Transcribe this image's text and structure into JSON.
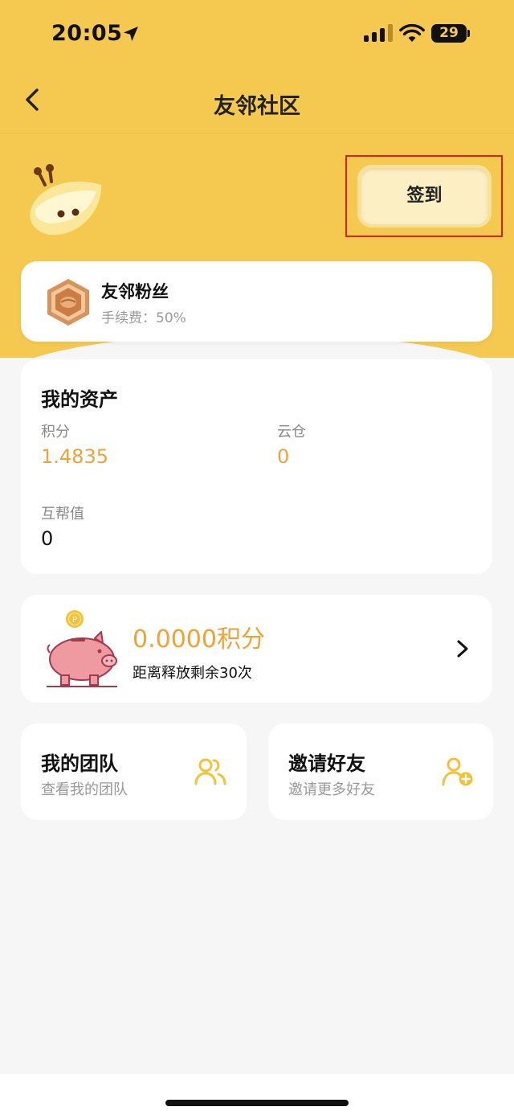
{
  "status_bar": {
    "time": "20:05",
    "battery": "29",
    "icons": [
      "location-arrow-icon",
      "cellular-signal-icon",
      "wifi-icon",
      "battery-icon"
    ]
  },
  "nav": {
    "title": "友邻社区",
    "back_icon": "chevron-left-icon"
  },
  "header": {
    "mascot_icon": "bee-mascot-icon",
    "sign_in_label": "签到"
  },
  "member": {
    "badge_icon": "hexagon-badge-icon",
    "title": "友邻粉丝",
    "fee_text": "手续费：50%"
  },
  "assets": {
    "title": "我的资产",
    "items": [
      {
        "label": "积分",
        "value": "1.4835"
      },
      {
        "label": "云仓",
        "value": "0"
      },
      {
        "label": "互帮值",
        "value": "0"
      }
    ]
  },
  "release": {
    "piggy_icon": "piggy-bank-icon",
    "amount": "0.0000积分",
    "remaining": "距离释放剩余30次",
    "arrow_icon": "chevron-right-icon"
  },
  "tiles": {
    "team": {
      "title": "我的团队",
      "subtitle": "查看我的团队",
      "icon": "users-icon"
    },
    "invite": {
      "title": "邀请好友",
      "subtitle": "邀请更多好友",
      "icon": "add-user-icon"
    }
  },
  "colors": {
    "header_bg": "#f5c94f",
    "accent_orange": "#f0a234",
    "icon_yellow": "#f2c23a",
    "page_bg": "#f6f6f6",
    "highlight_red": "#e02020"
  }
}
